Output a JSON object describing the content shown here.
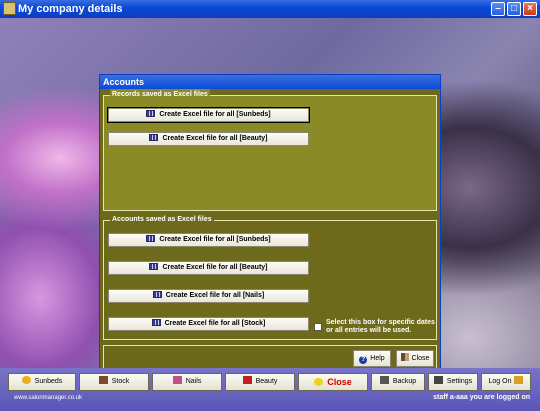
{
  "window": {
    "title": "My company details"
  },
  "dialog": {
    "title": "Accounts",
    "records_group": {
      "legend": "Records saved as Excel files",
      "buttons": [
        "Create Excel file for all [Sunbeds]",
        "Create Excel file for all [Beauty]"
      ]
    },
    "accounts_group": {
      "legend": "Accounts saved as Excel files",
      "buttons": [
        "Create Excel file for all [Sunbeds]",
        "Create Excel file for all [Beauty]",
        "Create Excel file for all [Nails]",
        "Create Excel file for all [Stock]"
      ],
      "checkbox_label_1": "Select this box for specific dates",
      "checkbox_label_2": "or all entries will be used."
    },
    "footer": {
      "help_label": "Help",
      "close_label": "Close"
    }
  },
  "toolbar": {
    "sunbeds": "Sunbeds",
    "stock": "Stock",
    "nails": "Nails",
    "beauty": "Beauty",
    "close": "Close",
    "backup": "Backup",
    "settings": "Settings",
    "logon": "Log On"
  },
  "status": {
    "url": "www.salonmanager.co.uk",
    "user": "staff a-aaa you are logged on"
  }
}
